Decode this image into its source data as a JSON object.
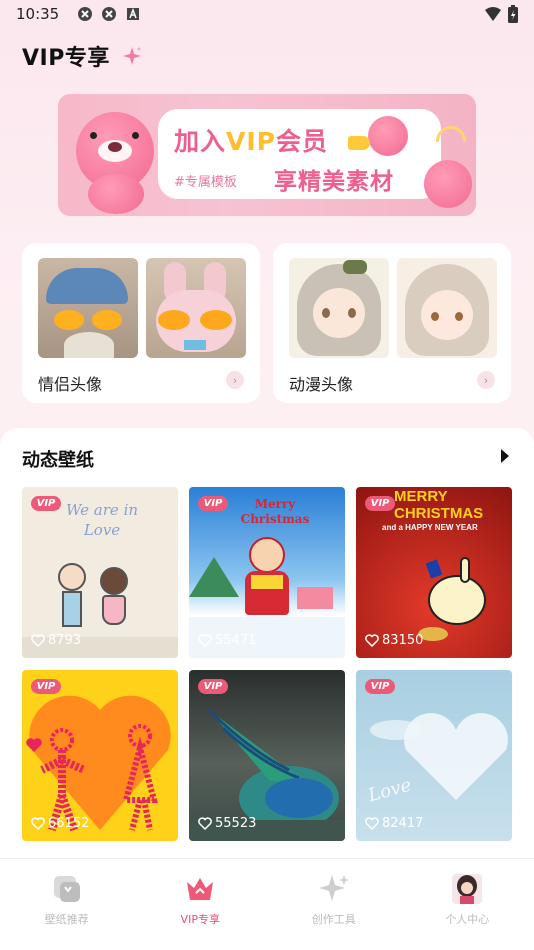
{
  "status_bar": {
    "time": "10:35"
  },
  "header": {
    "title": "VIP专享"
  },
  "banner": {
    "headline_prefix": "加入",
    "headline_vip": "VIP",
    "headline_suffix": "会员",
    "tag": "#专属模板",
    "subline": "享精美素材"
  },
  "categories": [
    {
      "label": "情侣头像"
    },
    {
      "label": "动漫头像"
    }
  ],
  "wallpaper_section": {
    "title": "动态壁纸",
    "badge": "VIP",
    "tiles": [
      {
        "likes": "8793",
        "text": "We are in Love"
      },
      {
        "likes": "55471",
        "text": "Merry Christmas"
      },
      {
        "likes": "83150",
        "text": "MERRY CHRISTMAS",
        "text2": "and a HAPPY NEW YEAR"
      },
      {
        "likes": "66152"
      },
      {
        "likes": "55523"
      },
      {
        "likes": "82417",
        "text": "Love"
      }
    ]
  },
  "bottom_nav": [
    {
      "label": "壁纸推荐",
      "icon": "wallpaper-icon"
    },
    {
      "label": "VIP专享",
      "icon": "crown-icon",
      "active": true
    },
    {
      "label": "创作工具",
      "icon": "sparkle-icon"
    },
    {
      "label": "个人中心",
      "icon": "avatar-icon"
    }
  ],
  "colors": {
    "accent": "#e94d73",
    "badge": "#ec5a78",
    "banner_pink": "#ee5f8e"
  }
}
